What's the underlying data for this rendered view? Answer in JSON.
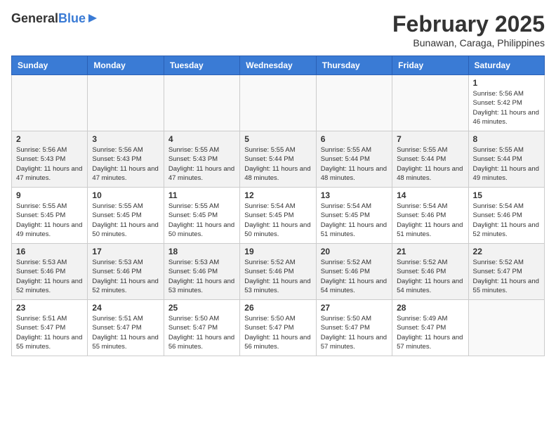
{
  "header": {
    "logo_general": "General",
    "logo_blue": "Blue",
    "month_year": "February 2025",
    "location": "Bunawan, Caraga, Philippines"
  },
  "weekdays": [
    "Sunday",
    "Monday",
    "Tuesday",
    "Wednesday",
    "Thursday",
    "Friday",
    "Saturday"
  ],
  "weeks": [
    [
      {
        "day": "",
        "sunrise": "",
        "sunset": "",
        "daylight": "",
        "empty": true
      },
      {
        "day": "",
        "sunrise": "",
        "sunset": "",
        "daylight": "",
        "empty": true
      },
      {
        "day": "",
        "sunrise": "",
        "sunset": "",
        "daylight": "",
        "empty": true
      },
      {
        "day": "",
        "sunrise": "",
        "sunset": "",
        "daylight": "",
        "empty": true
      },
      {
        "day": "",
        "sunrise": "",
        "sunset": "",
        "daylight": "",
        "empty": true
      },
      {
        "day": "",
        "sunrise": "",
        "sunset": "",
        "daylight": "",
        "empty": true
      },
      {
        "day": "1",
        "sunrise": "Sunrise: 5:56 AM",
        "sunset": "Sunset: 5:42 PM",
        "daylight": "Daylight: 11 hours and 46 minutes.",
        "empty": false
      }
    ],
    [
      {
        "day": "2",
        "sunrise": "Sunrise: 5:56 AM",
        "sunset": "Sunset: 5:43 PM",
        "daylight": "Daylight: 11 hours and 47 minutes.",
        "empty": false
      },
      {
        "day": "3",
        "sunrise": "Sunrise: 5:56 AM",
        "sunset": "Sunset: 5:43 PM",
        "daylight": "Daylight: 11 hours and 47 minutes.",
        "empty": false
      },
      {
        "day": "4",
        "sunrise": "Sunrise: 5:55 AM",
        "sunset": "Sunset: 5:43 PM",
        "daylight": "Daylight: 11 hours and 47 minutes.",
        "empty": false
      },
      {
        "day": "5",
        "sunrise": "Sunrise: 5:55 AM",
        "sunset": "Sunset: 5:44 PM",
        "daylight": "Daylight: 11 hours and 48 minutes.",
        "empty": false
      },
      {
        "day": "6",
        "sunrise": "Sunrise: 5:55 AM",
        "sunset": "Sunset: 5:44 PM",
        "daylight": "Daylight: 11 hours and 48 minutes.",
        "empty": false
      },
      {
        "day": "7",
        "sunrise": "Sunrise: 5:55 AM",
        "sunset": "Sunset: 5:44 PM",
        "daylight": "Daylight: 11 hours and 48 minutes.",
        "empty": false
      },
      {
        "day": "8",
        "sunrise": "Sunrise: 5:55 AM",
        "sunset": "Sunset: 5:44 PM",
        "daylight": "Daylight: 11 hours and 49 minutes.",
        "empty": false
      }
    ],
    [
      {
        "day": "9",
        "sunrise": "Sunrise: 5:55 AM",
        "sunset": "Sunset: 5:45 PM",
        "daylight": "Daylight: 11 hours and 49 minutes.",
        "empty": false
      },
      {
        "day": "10",
        "sunrise": "Sunrise: 5:55 AM",
        "sunset": "Sunset: 5:45 PM",
        "daylight": "Daylight: 11 hours and 50 minutes.",
        "empty": false
      },
      {
        "day": "11",
        "sunrise": "Sunrise: 5:55 AM",
        "sunset": "Sunset: 5:45 PM",
        "daylight": "Daylight: 11 hours and 50 minutes.",
        "empty": false
      },
      {
        "day": "12",
        "sunrise": "Sunrise: 5:54 AM",
        "sunset": "Sunset: 5:45 PM",
        "daylight": "Daylight: 11 hours and 50 minutes.",
        "empty": false
      },
      {
        "day": "13",
        "sunrise": "Sunrise: 5:54 AM",
        "sunset": "Sunset: 5:45 PM",
        "daylight": "Daylight: 11 hours and 51 minutes.",
        "empty": false
      },
      {
        "day": "14",
        "sunrise": "Sunrise: 5:54 AM",
        "sunset": "Sunset: 5:46 PM",
        "daylight": "Daylight: 11 hours and 51 minutes.",
        "empty": false
      },
      {
        "day": "15",
        "sunrise": "Sunrise: 5:54 AM",
        "sunset": "Sunset: 5:46 PM",
        "daylight": "Daylight: 11 hours and 52 minutes.",
        "empty": false
      }
    ],
    [
      {
        "day": "16",
        "sunrise": "Sunrise: 5:53 AM",
        "sunset": "Sunset: 5:46 PM",
        "daylight": "Daylight: 11 hours and 52 minutes.",
        "empty": false
      },
      {
        "day": "17",
        "sunrise": "Sunrise: 5:53 AM",
        "sunset": "Sunset: 5:46 PM",
        "daylight": "Daylight: 11 hours and 52 minutes.",
        "empty": false
      },
      {
        "day": "18",
        "sunrise": "Sunrise: 5:53 AM",
        "sunset": "Sunset: 5:46 PM",
        "daylight": "Daylight: 11 hours and 53 minutes.",
        "empty": false
      },
      {
        "day": "19",
        "sunrise": "Sunrise: 5:52 AM",
        "sunset": "Sunset: 5:46 PM",
        "daylight": "Daylight: 11 hours and 53 minutes.",
        "empty": false
      },
      {
        "day": "20",
        "sunrise": "Sunrise: 5:52 AM",
        "sunset": "Sunset: 5:46 PM",
        "daylight": "Daylight: 11 hours and 54 minutes.",
        "empty": false
      },
      {
        "day": "21",
        "sunrise": "Sunrise: 5:52 AM",
        "sunset": "Sunset: 5:46 PM",
        "daylight": "Daylight: 11 hours and 54 minutes.",
        "empty": false
      },
      {
        "day": "22",
        "sunrise": "Sunrise: 5:52 AM",
        "sunset": "Sunset: 5:47 PM",
        "daylight": "Daylight: 11 hours and 55 minutes.",
        "empty": false
      }
    ],
    [
      {
        "day": "23",
        "sunrise": "Sunrise: 5:51 AM",
        "sunset": "Sunset: 5:47 PM",
        "daylight": "Daylight: 11 hours and 55 minutes.",
        "empty": false
      },
      {
        "day": "24",
        "sunrise": "Sunrise: 5:51 AM",
        "sunset": "Sunset: 5:47 PM",
        "daylight": "Daylight: 11 hours and 55 minutes.",
        "empty": false
      },
      {
        "day": "25",
        "sunrise": "Sunrise: 5:50 AM",
        "sunset": "Sunset: 5:47 PM",
        "daylight": "Daylight: 11 hours and 56 minutes.",
        "empty": false
      },
      {
        "day": "26",
        "sunrise": "Sunrise: 5:50 AM",
        "sunset": "Sunset: 5:47 PM",
        "daylight": "Daylight: 11 hours and 56 minutes.",
        "empty": false
      },
      {
        "day": "27",
        "sunrise": "Sunrise: 5:50 AM",
        "sunset": "Sunset: 5:47 PM",
        "daylight": "Daylight: 11 hours and 57 minutes.",
        "empty": false
      },
      {
        "day": "28",
        "sunrise": "Sunrise: 5:49 AM",
        "sunset": "Sunset: 5:47 PM",
        "daylight": "Daylight: 11 hours and 57 minutes.",
        "empty": false
      },
      {
        "day": "",
        "sunrise": "",
        "sunset": "",
        "daylight": "",
        "empty": true
      }
    ]
  ]
}
